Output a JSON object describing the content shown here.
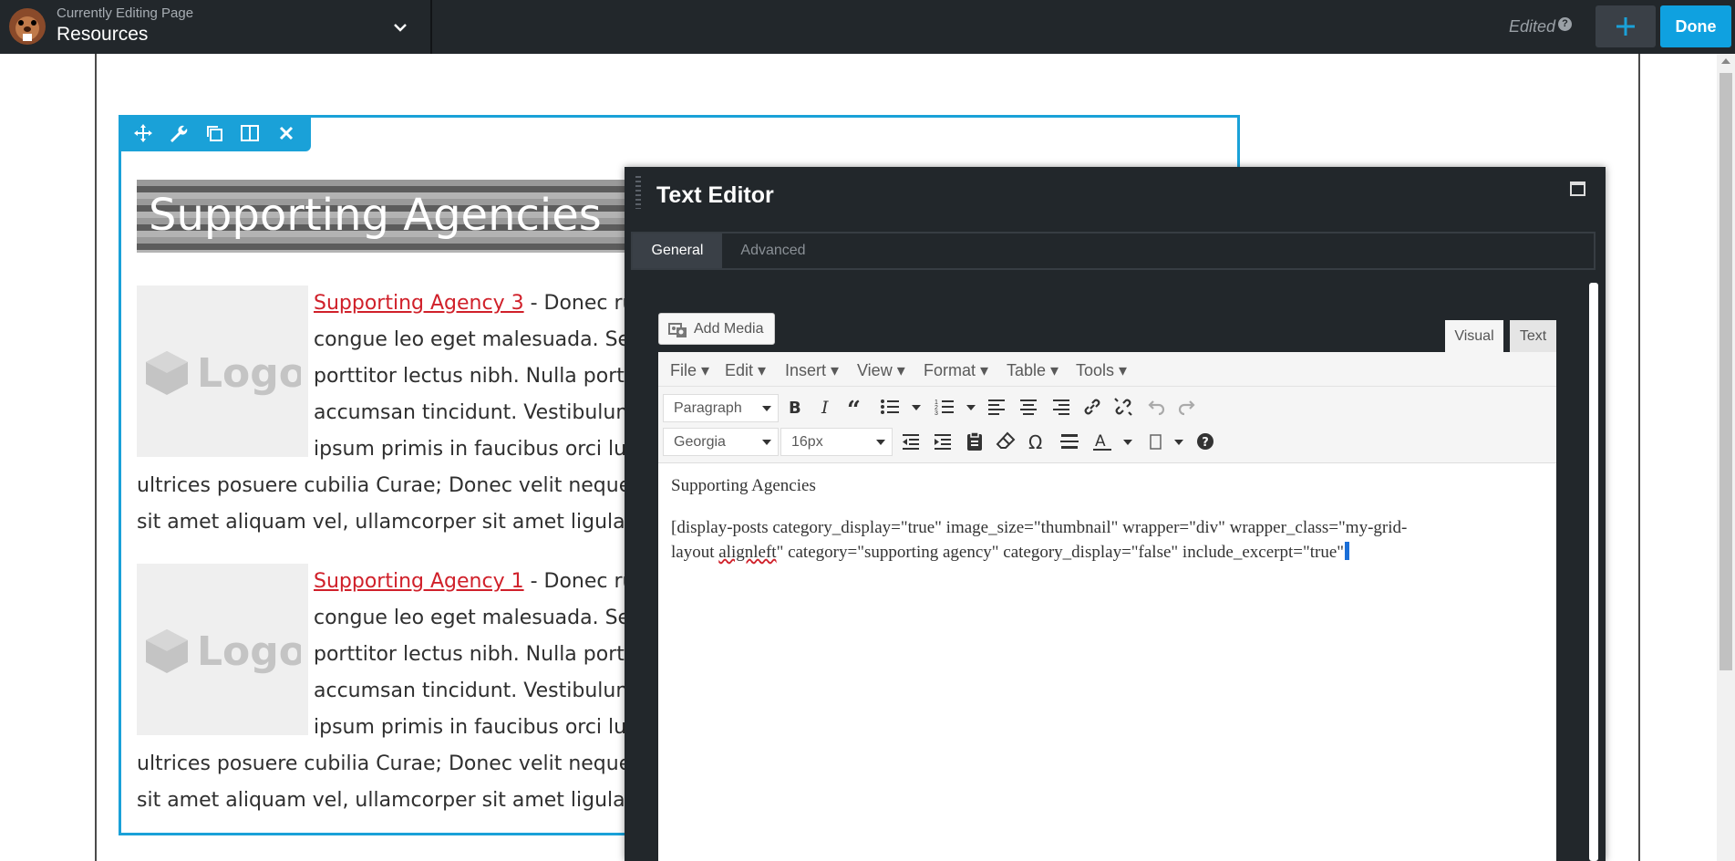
{
  "topbar": {
    "subtitle": "Currently Editing Page",
    "page_name": "Resources",
    "edited_label": "Edited",
    "help_label": "?",
    "done_label": "Done"
  },
  "module": {
    "heading": "Supporting Agencies",
    "posts": [
      {
        "link": "Supporting Agency 3",
        "line1": " - Donec rutr",
        "line2": "congue leo eget malesuada. Sed",
        "line3": "porttitor lectus nibh. Nulla portti",
        "line4": "accumsan tincidunt. Vestibulum",
        "line5": "ipsum primis in faucibus orci luct",
        "line6": "ultrices posuere cubilia Curae; Donec velit neque, au",
        "line7": "sit amet aliquam vel, ullamcorper sit amet ligula."
      },
      {
        "link": "Supporting Agency 1",
        "line1": " - Donec rutr",
        "line2": "congue leo eget malesuada. Sed",
        "line3": "porttitor lectus nibh. Nulla portti",
        "line4": "accumsan tincidunt. Vestibulum",
        "line5": "ipsum primis in faucibus orci luct",
        "line6": "ultrices posuere cubilia Curae; Donec velit neque, au",
        "line7": "sit amet aliquam vel, ullamcorper sit amet ligula."
      }
    ],
    "logo_text": "Logo"
  },
  "editor": {
    "title": "Text Editor",
    "tabs": [
      "General",
      "Advanced"
    ],
    "add_media": "Add Media",
    "view_tabs": [
      "Visual",
      "Text"
    ],
    "menus": [
      "File",
      "Edit",
      "Insert",
      "View",
      "Format",
      "Table",
      "Tools"
    ],
    "format_select": "Paragraph",
    "font_select": "Georgia",
    "size_select": "16px",
    "content_title": "Supporting Agencies",
    "code_line1": "[display-posts category_display=\"true\" image_size=\"thumbnail\" wrapper=\"div\" wrapper_class=\"my-grid-",
    "code_line2_a": "layout ",
    "code_line2_spell": "alignleft",
    "code_line2_b": "\" category=\"supporting agency\" category_display=\"false\" include_excerpt=\"true\""
  },
  "colors": {
    "accent": "#1aa1d8",
    "done": "#0fa1e0",
    "link": "#d0202a",
    "dark": "#22272b"
  }
}
